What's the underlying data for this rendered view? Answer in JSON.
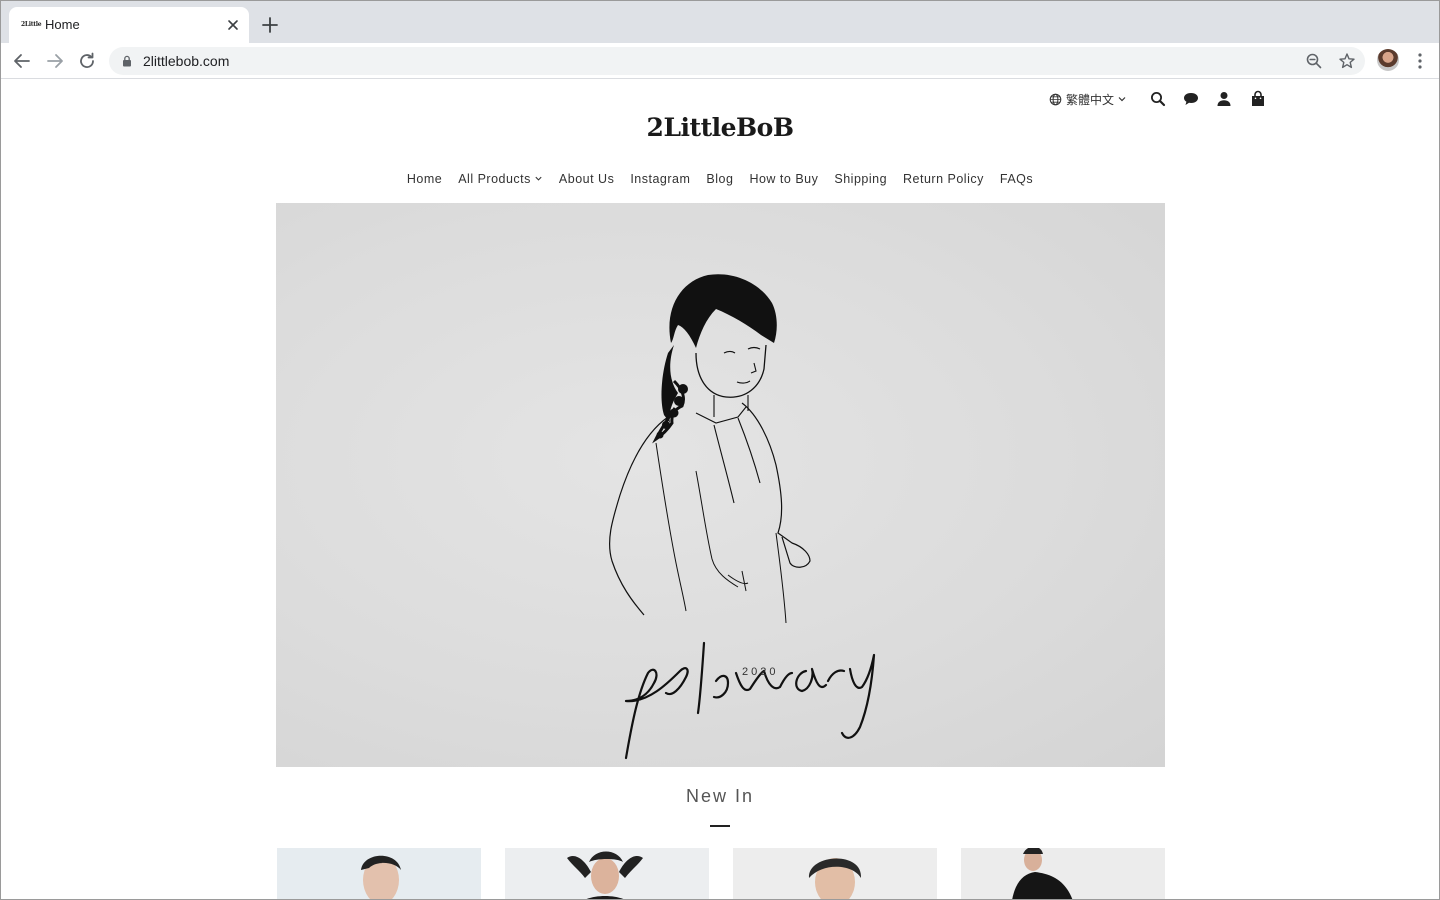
{
  "browser": {
    "tab": {
      "title": "Home",
      "favicon_text": "2Little"
    },
    "url": "2littlebob.com",
    "icons": [
      "back-arrow-icon",
      "forward-arrow-icon",
      "reload-icon",
      "lock-icon",
      "zoom-out-icon",
      "star-icon",
      "profile-avatar",
      "more-vert-icon"
    ]
  },
  "site": {
    "logo": "2LittleBoB",
    "language": "繁體中文",
    "nav": [
      "Home",
      "All Products",
      "About Us",
      "Instagram",
      "Blog",
      "How to Buy",
      "Shipping",
      "Return Policy",
      "FAQs"
    ],
    "hero": {
      "script_text": "february",
      "year": "2020"
    },
    "new_in_title": "New In",
    "colors": {
      "accent": "#1a1a1a",
      "hero_bg": "#dcdcdc",
      "tabstrip": "#dee1e6"
    }
  }
}
